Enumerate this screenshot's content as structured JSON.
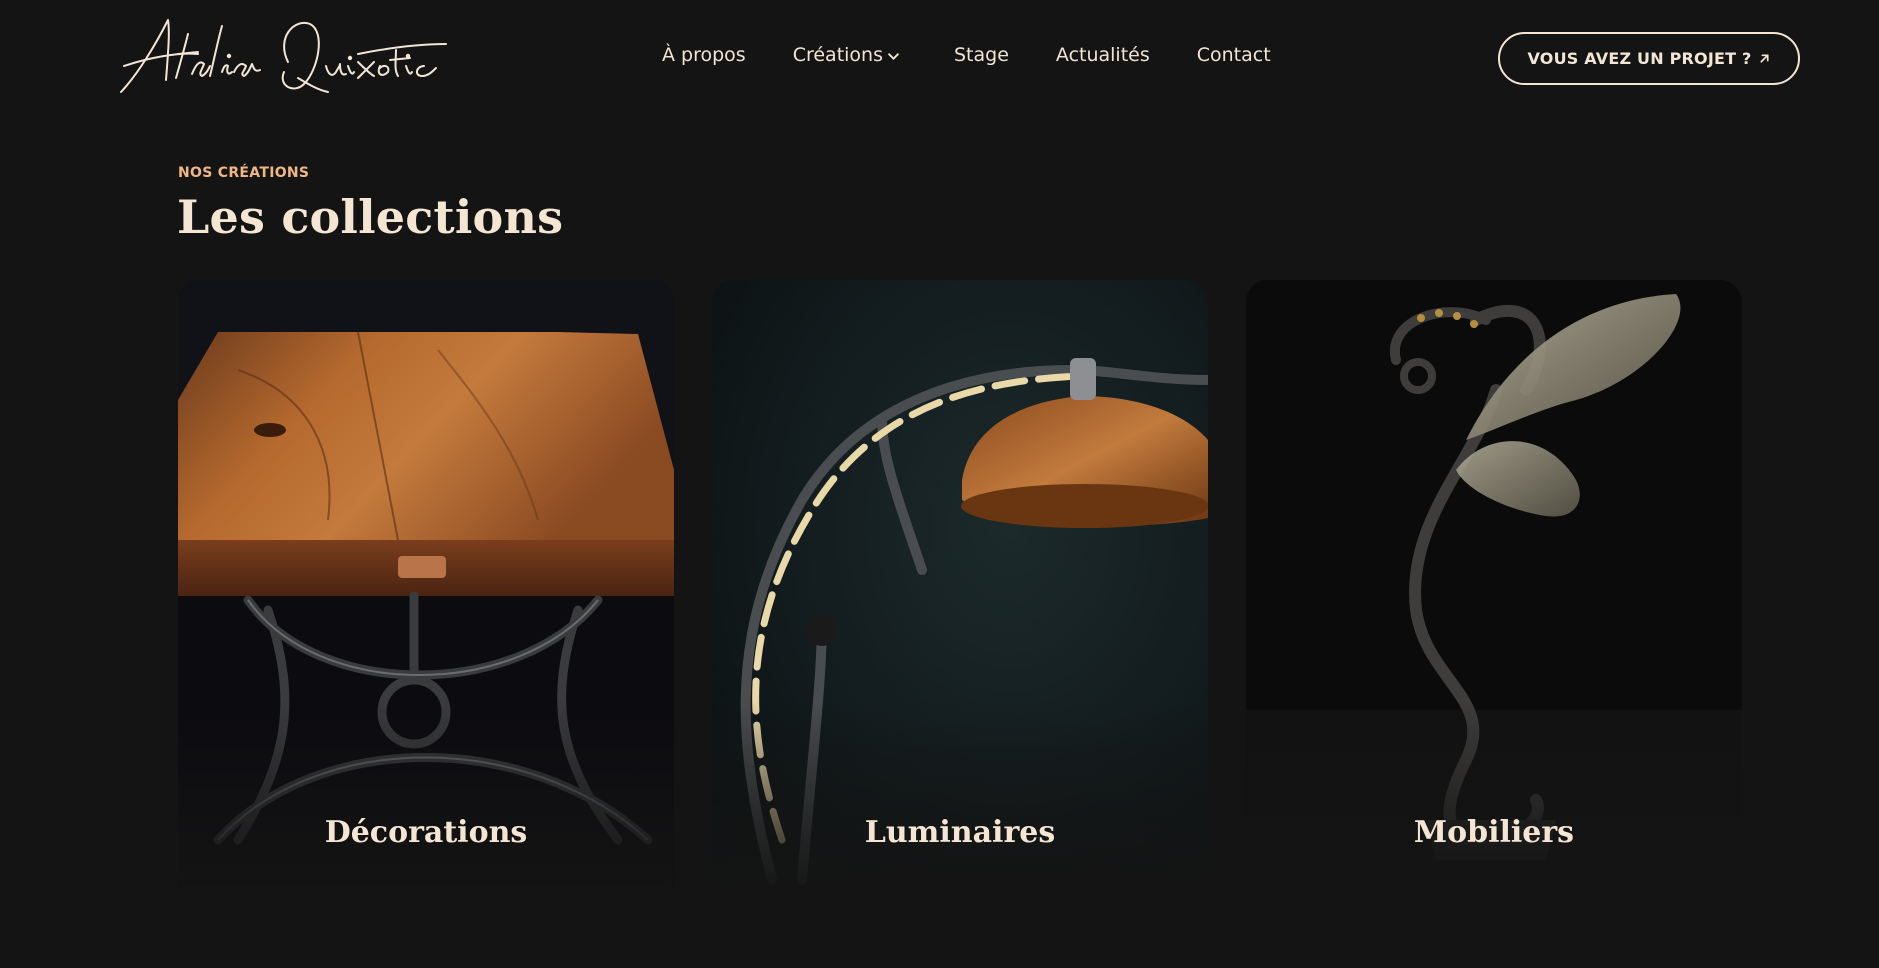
{
  "brand": {
    "logo_text": "Atelier Quixotic",
    "colors": {
      "background": "#141414",
      "text": "#f3e6d6",
      "accent": "#f0b785"
    }
  },
  "nav": {
    "items": [
      {
        "label": "À propos"
      },
      {
        "label": "Créations",
        "icon": "chevron-down-icon"
      },
      {
        "label": "Stage"
      },
      {
        "label": "Actualités"
      },
      {
        "label": "Contact"
      }
    ]
  },
  "cta": {
    "label": "VOUS AVEZ UN PROJET ?",
    "icon": "arrow-up-right-icon"
  },
  "section": {
    "eyebrow": "NOS CRÉATIONS",
    "title": "Les collections"
  },
  "collections": [
    {
      "title": "Décorations",
      "image": "wooden table with forged iron base"
    },
    {
      "title": "Luminaires",
      "image": "forged iron lamp with copper shade"
    },
    {
      "title": "Mobiliers",
      "image": "forged iron sculpture with glass wings"
    }
  ]
}
